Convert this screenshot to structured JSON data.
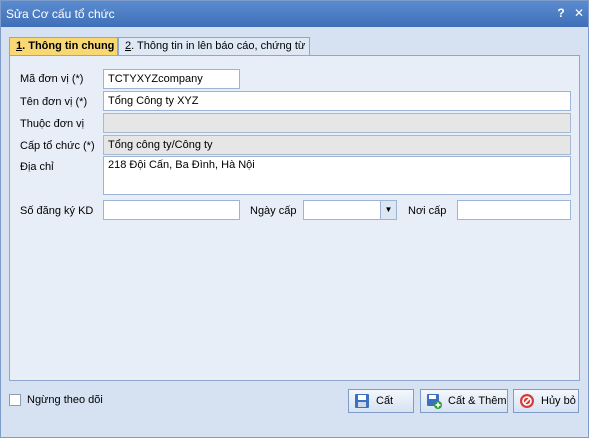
{
  "window": {
    "title": "Sửa Cơ cấu tổ chức",
    "help_glyph": "?",
    "close_glyph": "✕"
  },
  "tabs": [
    {
      "number": "1",
      "label": ". Thông tin chung",
      "active": true
    },
    {
      "number": "2",
      "label": ". Thông tin in lên báo cáo, chứng từ",
      "active": false
    }
  ],
  "form": {
    "ma_don_vi": {
      "label": "Mã đơn vị (*)",
      "value": "TCTYXYZcompany"
    },
    "ten_don_vi": {
      "label": "Tên đơn vị (*)",
      "value": "Tổng Công ty XYZ"
    },
    "thuoc_don_vi": {
      "label": "Thuộc đơn vị",
      "value": ""
    },
    "cap_to_chuc": {
      "label": "Cấp tổ chức (*)",
      "value": "Tổng công ty/Công ty"
    },
    "dia_chi": {
      "label": "Địa chỉ",
      "value": "218 Đội Cấn, Ba Đình, Hà Nội"
    },
    "so_dang_ky": {
      "label": "Số đăng ký KD",
      "value": ""
    },
    "ngay_cap": {
      "label": "Ngày cấp",
      "value": ""
    },
    "noi_cap": {
      "label": "Nơi cấp",
      "value": ""
    }
  },
  "footer": {
    "stop_tracking_label": "Ngừng theo dõi",
    "save_label": "Cất",
    "save_new_label": "Cất & Thêm",
    "cancel_label": "Hủy bỏ"
  },
  "colors": {
    "titlebar": "#4a7cc3",
    "active_tab": "#f8d873"
  }
}
